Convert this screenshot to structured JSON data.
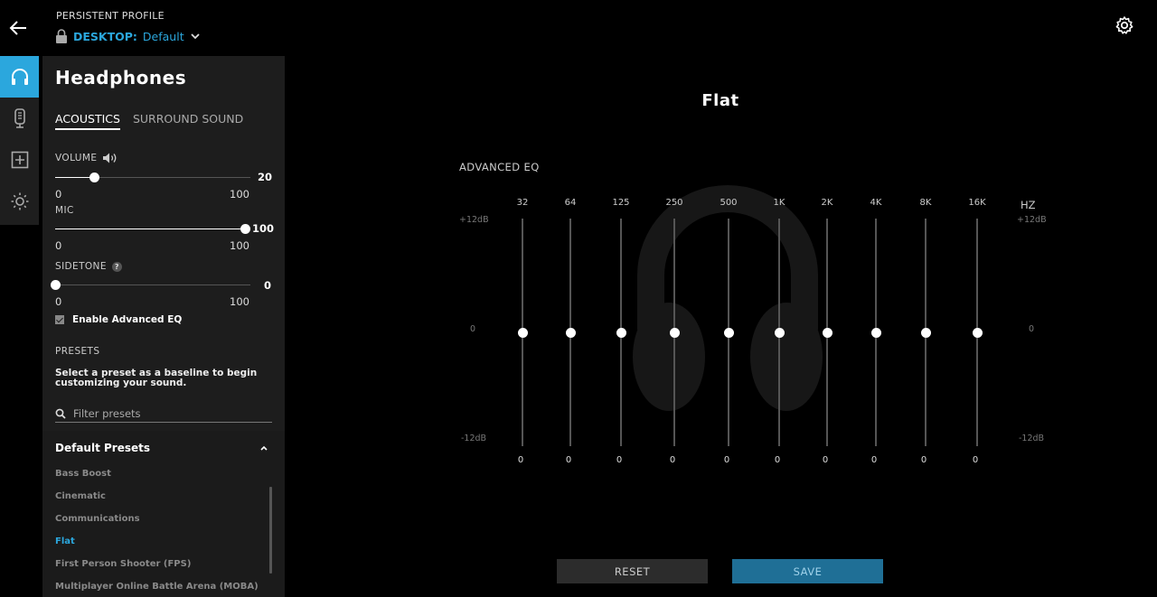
{
  "header": {
    "profile_label": "PERSISTENT PROFILE",
    "profile_device": "DESKTOP:",
    "profile_name": "Default",
    "icons": [
      "back-arrow-icon",
      "lock-icon",
      "chevron-down-icon",
      "gear-icon"
    ]
  },
  "rail": {
    "items": [
      {
        "icon": "headphones-icon",
        "active": true
      },
      {
        "icon": "microphone-icon",
        "active": false
      },
      {
        "icon": "add-box-icon",
        "active": false
      },
      {
        "icon": "lighting-icon",
        "active": false
      }
    ]
  },
  "panel": {
    "title": "Headphones",
    "tabs": [
      {
        "label": "ACOUSTICS",
        "active": true
      },
      {
        "label": "SURROUND SOUND",
        "active": false
      }
    ],
    "volume": {
      "label": "VOLUME",
      "value": "20",
      "min": "0",
      "max": "100",
      "level": 20
    },
    "mic": {
      "label": "MIC",
      "value": "100",
      "min": "0",
      "max": "100",
      "level": 100
    },
    "sidetone": {
      "label": "SIDETONE",
      "help": "?",
      "value": "0",
      "min": "0",
      "max": "100",
      "level": 0
    },
    "advanced_eq": {
      "label": "Enable Advanced EQ",
      "checked": true
    },
    "presets": {
      "heading": "PRESETS",
      "description": "Select a preset as a baseline to begin customizing your sound.",
      "filter_placeholder": "Filter presets",
      "group": "Default Presets",
      "items": [
        {
          "label": "Bass Boost",
          "active": false
        },
        {
          "label": "Cinematic",
          "active": false
        },
        {
          "label": "Communications",
          "active": false
        },
        {
          "label": "Flat",
          "active": true
        },
        {
          "label": "First Person Shooter (FPS)",
          "active": false
        },
        {
          "label": "Multiplayer Online Battle Arena (MOBA)",
          "active": false
        }
      ]
    }
  },
  "eq": {
    "preset_title": "Flat",
    "heading": "ADVANCED EQ",
    "unit": "HZ",
    "db_top": "+12dB",
    "db_mid": "0",
    "db_bottom": "-12dB",
    "bands": [
      {
        "freq": "32",
        "value": "0"
      },
      {
        "freq": "64",
        "value": "0"
      },
      {
        "freq": "125",
        "value": "0"
      },
      {
        "freq": "250",
        "value": "0"
      },
      {
        "freq": "500",
        "value": "0"
      },
      {
        "freq": "1K",
        "value": "0"
      },
      {
        "freq": "2K",
        "value": "0"
      },
      {
        "freq": "4K",
        "value": "0"
      },
      {
        "freq": "8K",
        "value": "0"
      },
      {
        "freq": "16K",
        "value": "0"
      }
    ]
  },
  "actions": {
    "reset": "RESET",
    "save": "SAVE"
  },
  "colors": {
    "accent": "#2ba7dd",
    "save_bg": "#1f6f96",
    "panel_bg": "#1d1d1d"
  }
}
